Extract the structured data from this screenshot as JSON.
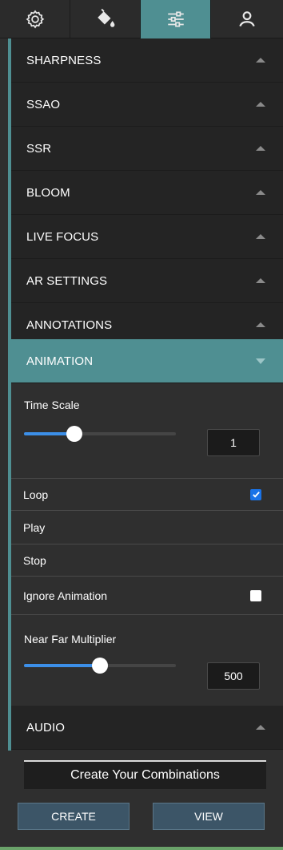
{
  "toolbar": {
    "tabs": [
      {
        "icon": "gear-icon",
        "active": false
      },
      {
        "icon": "paint-bucket-icon",
        "active": false
      },
      {
        "icon": "sliders-icon",
        "active": true
      },
      {
        "icon": "user-icon",
        "active": false
      }
    ]
  },
  "sections": [
    {
      "label": "SHARPNESS",
      "open": false
    },
    {
      "label": "SSAO",
      "open": false
    },
    {
      "label": "SSR",
      "open": false
    },
    {
      "label": "BLOOM",
      "open": false
    },
    {
      "label": "LIVE FOCUS",
      "open": false
    },
    {
      "label": "AR SETTINGS",
      "open": false
    },
    {
      "label": "ANNOTATIONS",
      "open": false
    },
    {
      "label": "ANIMATION",
      "open": true
    }
  ],
  "animation": {
    "time_scale": {
      "label": "Time Scale",
      "value": "1",
      "slider_fraction": 0.33
    },
    "loop": {
      "label": "Loop",
      "checked": true
    },
    "play_label": "Play",
    "stop_label": "Stop",
    "ignore_animation": {
      "label": "Ignore Animation",
      "checked": false
    },
    "near_far": {
      "label": "Near Far Multiplier",
      "value": "500",
      "slider_fraction": 0.5
    }
  },
  "audio": {
    "label": "AUDIO",
    "open": false
  },
  "combinations": {
    "title": "Create Your Combinations",
    "create_label": "CREATE",
    "view_label": "VIEW"
  },
  "colors": {
    "accent": "#4f8f92",
    "checkbox_checked": "#1a73e8",
    "slider_fill": "#3c8fe8",
    "button_bg": "#3c5567"
  }
}
